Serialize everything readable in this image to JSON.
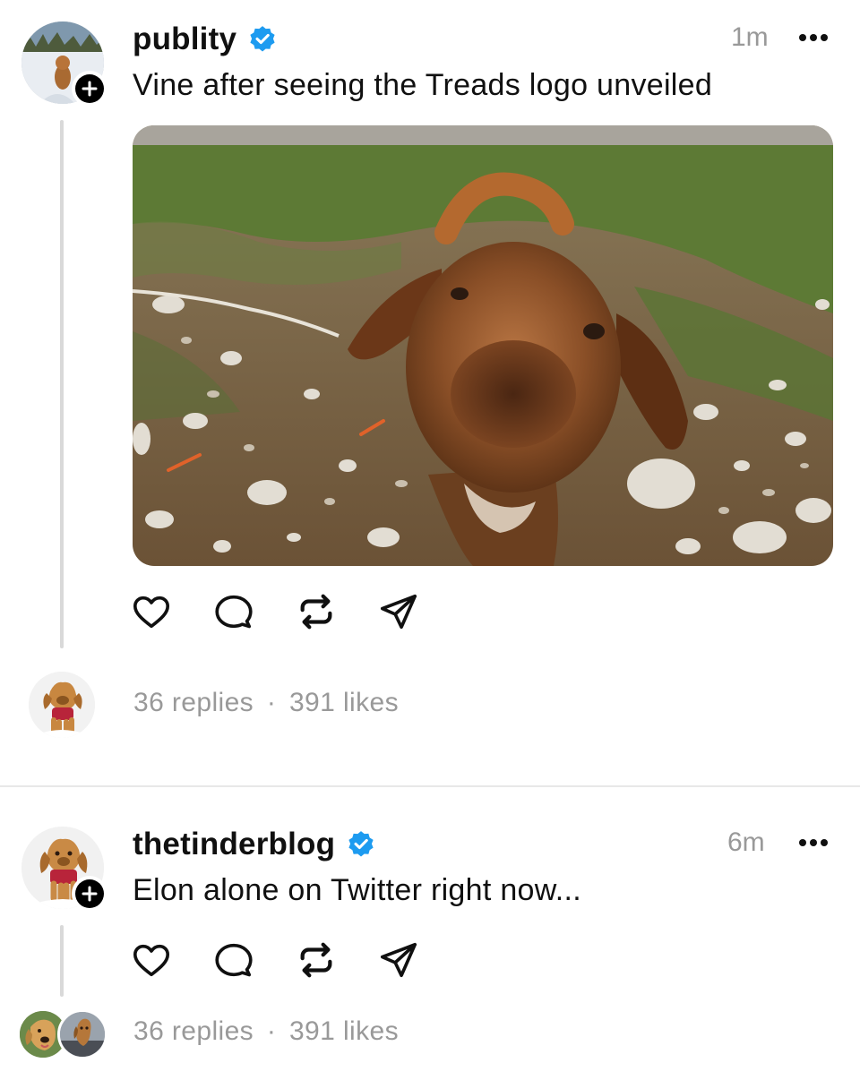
{
  "posts": [
    {
      "username": "publity",
      "verified": true,
      "time": "1m",
      "text": "Vine after seeing the Treads logo unveiled",
      "media": "photo of a puppy sniffing the camera on a gravel and grass field",
      "stats": {
        "replies": "36 replies",
        "separator": "·",
        "likes": "391 likes"
      }
    },
    {
      "username": "thetinderblog",
      "verified": true,
      "time": "6m",
      "text": "Elon alone on Twitter right now...",
      "stats": {
        "replies": "36 replies",
        "separator": "·",
        "likes": "391 likes"
      }
    }
  ],
  "icons": {
    "verified": "verified-badge-icon",
    "more": "more-options-icon",
    "follow": "plus-icon",
    "like": "heart-icon",
    "reply": "comment-icon",
    "repost": "repost-icon",
    "share": "send-icon"
  },
  "colors": {
    "verified": "#1d9bf0",
    "secondary_text": "#999999",
    "primary_text": "#101010",
    "thread_line": "#d9d9d9"
  }
}
